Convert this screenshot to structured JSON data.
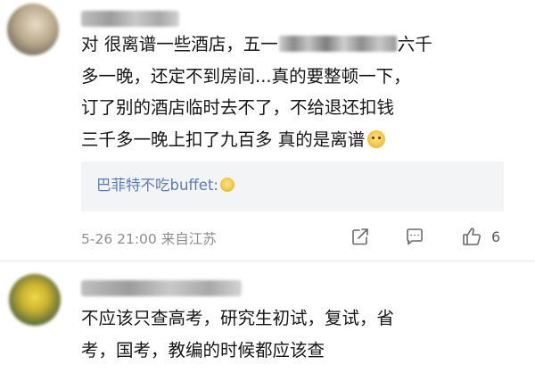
{
  "comments": [
    {
      "text_line1_before": "对 很离谱一些酒店，五一",
      "text_line1_after": "六千",
      "text_rest": "多一晚，还定不到房间...真的要整顿一下，\n订了别的酒店临时去不了，不给退还扣钱\n三千多一晚上扣了九百多 真的是离谱",
      "reply": {
        "text": "巴菲特不吃buffet:"
      },
      "date": "5-26 21:00",
      "source": "来自江苏",
      "like_count": "6",
      "icons": {
        "share": "share-icon",
        "comment": "comment-icon",
        "like": "thumbs-up-icon"
      }
    },
    {
      "text": "不应该只查高考，研究生初试，复试，省\n考，国考，教编的时候都应该查"
    }
  ],
  "colors": {
    "background": "#ffffff",
    "text": "#161616",
    "meta": "#8d8d8d",
    "reply_link": "#5a7bb7",
    "reply_bg": "#f3f4f6",
    "divider": "#e6e6e6"
  }
}
